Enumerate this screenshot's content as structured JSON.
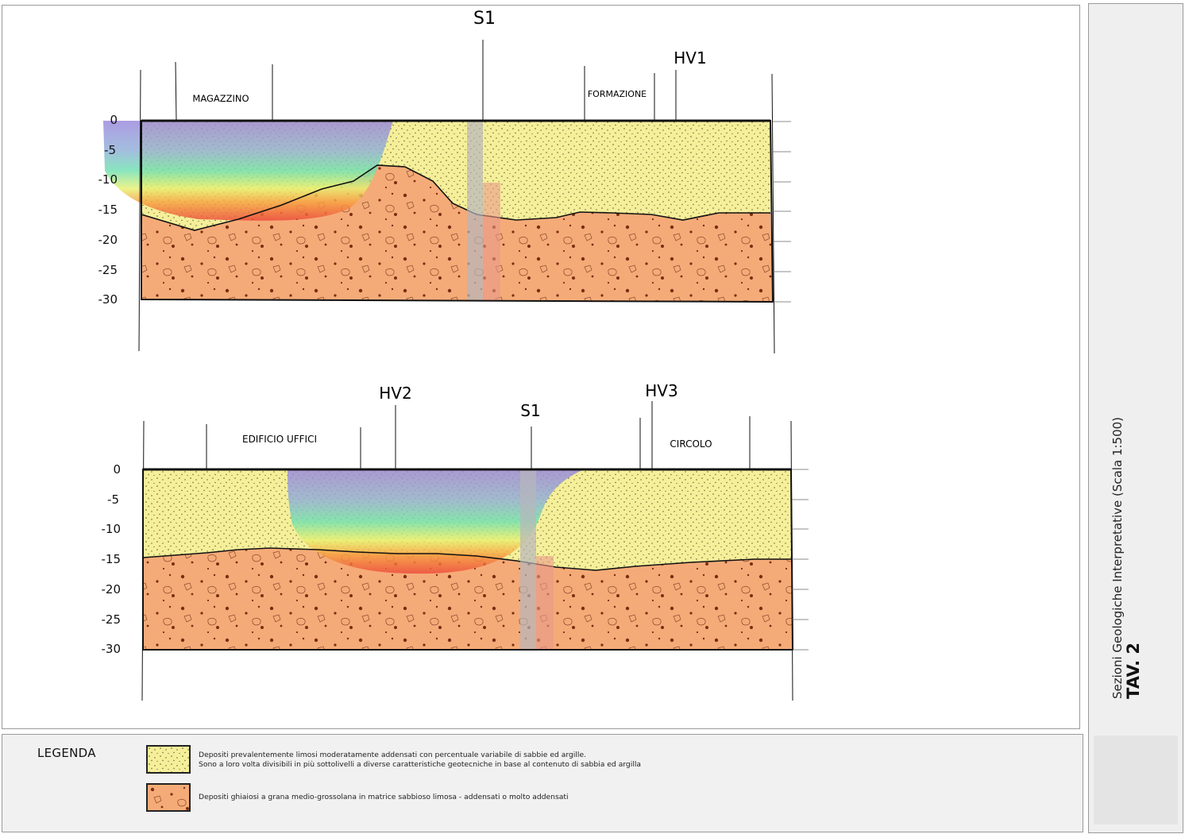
{
  "title": {
    "code": "TAV. 2",
    "subtitle": "Sezioni Geologiche Interpretative (Scala 1:500)"
  },
  "depth_ticks": [
    "0",
    "-5",
    "-10",
    "-15",
    "-20",
    "-25",
    "-30"
  ],
  "sections": [
    {
      "id": "section-1",
      "boreholes": [
        "S1",
        "HV1"
      ],
      "labels": [
        "MAGAZZINO",
        "FORMAZIONE"
      ]
    },
    {
      "id": "section-2",
      "boreholes": [
        "HV2",
        "S1",
        "HV3"
      ],
      "labels": [
        "EDIFICIO UFFICI",
        "CIRCOLO"
      ]
    }
  ],
  "legend": {
    "title": "LEGENDA",
    "items": [
      {
        "swatch_color": "#f5ef9a",
        "line1": "Depositi prevalentemente limosi moderatamente addensati con percentuale variabile di sabbie ed argille.",
        "line2": "Sono a loro volta divisibili in più sottolivelli a diverse caratteristiche geotecniche in base al contenuto di sabbia ed argilla"
      },
      {
        "swatch_color": "#f5ab78",
        "line1": "Depositi ghiaiosi  a grana medio-grossolana in matrice sabbioso limosa - addensati o molto addensati",
        "line2": ""
      }
    ]
  },
  "colors": {
    "silt": "#f5ef9a",
    "gravel": "#f5ab78",
    "frame": "#9a9a9a"
  }
}
